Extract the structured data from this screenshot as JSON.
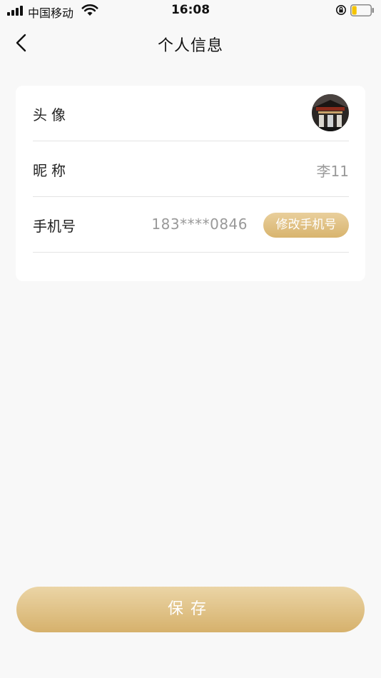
{
  "status_bar": {
    "carrier": "中国移动",
    "time": "16:08",
    "battery_level": 0.25,
    "battery_color": "#f5c400"
  },
  "nav": {
    "title": "个人信息",
    "back_icon": "chevron-left-icon"
  },
  "profile": {
    "avatar_label": "头像",
    "nickname_label": "昵称",
    "nickname_value": "李11",
    "phone_label": "手机号",
    "phone_value": "183****0846",
    "change_phone_label": "修改手机号"
  },
  "save_label": "保存",
  "colors": {
    "accent": "#d8b46e",
    "background": "#f8f8f8",
    "card": "#ffffff",
    "muted_text": "#999999"
  }
}
